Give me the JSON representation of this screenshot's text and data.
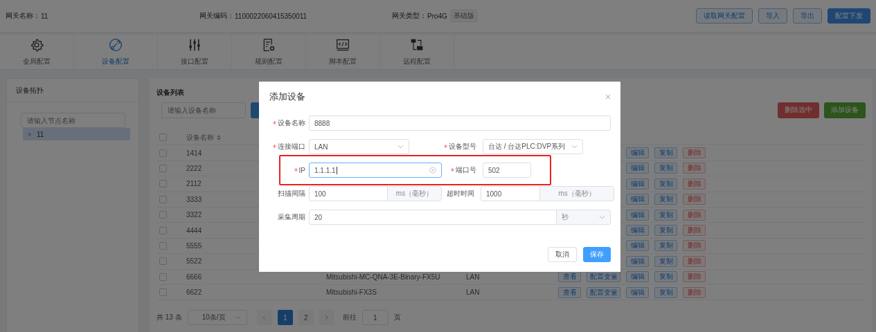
{
  "header": {
    "fields": [
      {
        "label": "网关名称：",
        "value": "11"
      },
      {
        "label": "网关编码：",
        "value": "1100022060415350011"
      },
      {
        "label": "网关类型：",
        "value": "Pro4G",
        "tag": "基础版"
      }
    ],
    "buttons": [
      {
        "label": "读取网关配置",
        "kind": "outline"
      },
      {
        "label": "导入",
        "kind": "outline"
      },
      {
        "label": "导出",
        "kind": "outline"
      },
      {
        "label": "配置下发",
        "kind": "primary"
      }
    ]
  },
  "nav": [
    {
      "label": "全局配置",
      "selected": false
    },
    {
      "label": "设备配置",
      "selected": true
    },
    {
      "label": "接口配置",
      "selected": false
    },
    {
      "label": "规则配置",
      "selected": false
    },
    {
      "label": "脚本配置",
      "selected": false
    },
    {
      "label": "远程配置",
      "selected": false
    }
  ],
  "topology": {
    "title": "设备拓扑",
    "search": {
      "placeholder": "请输入节点名称"
    },
    "tree": [
      {
        "label": "11",
        "expanded": false,
        "selected": true
      }
    ]
  },
  "device_list": {
    "title": "设备列表",
    "search": {
      "placeholder": "请输入设备名称"
    },
    "buttons": [
      {
        "label": "删除选中",
        "kind": "danger"
      },
      {
        "label": "添加设备",
        "kind": "success"
      }
    ],
    "header_checked": false,
    "columns": [
      {
        "label": "设备名称",
        "sortable": true
      }
    ],
    "rows": [
      {
        "checked": false,
        "name": "1414",
        "actions": [
          {
            "label": "编辑",
            "kind": "edit"
          },
          {
            "label": "复制",
            "kind": "copy"
          },
          {
            "label": "删除",
            "kind": "delete"
          }
        ]
      },
      {
        "checked": false,
        "name": "2222",
        "actions": [
          {
            "label": "编辑",
            "kind": "edit"
          },
          {
            "label": "复制",
            "kind": "copy"
          },
          {
            "label": "删除",
            "kind": "delete"
          }
        ]
      },
      {
        "checked": false,
        "name": "2112",
        "actions": [
          {
            "label": "编辑",
            "kind": "edit"
          },
          {
            "label": "复制",
            "kind": "copy"
          },
          {
            "label": "删除",
            "kind": "delete"
          }
        ]
      },
      {
        "checked": false,
        "name": "3333",
        "actions": [
          {
            "label": "编辑",
            "kind": "edit"
          },
          {
            "label": "复制",
            "kind": "copy"
          },
          {
            "label": "删除",
            "kind": "delete"
          }
        ]
      },
      {
        "checked": false,
        "name": "3322",
        "actions": [
          {
            "label": "编辑",
            "kind": "edit"
          },
          {
            "label": "复制",
            "kind": "copy"
          },
          {
            "label": "删除",
            "kind": "delete"
          }
        ]
      },
      {
        "checked": false,
        "name": "4444",
        "actions": [
          {
            "label": "编辑",
            "kind": "edit"
          },
          {
            "label": "复制",
            "kind": "copy"
          },
          {
            "label": "删除",
            "kind": "delete"
          }
        ]
      },
      {
        "checked": false,
        "name": "5555",
        "actions": [
          {
            "label": "编辑",
            "kind": "edit"
          },
          {
            "label": "复制",
            "kind": "copy"
          },
          {
            "label": "删除",
            "kind": "delete"
          }
        ]
      },
      {
        "checked": false,
        "name": "5522",
        "actions": [
          {
            "label": "编辑",
            "kind": "edit"
          },
          {
            "label": "复制",
            "kind": "copy"
          },
          {
            "label": "删除",
            "kind": "delete"
          }
        ]
      },
      {
        "checked": false,
        "name": "6666",
        "model": "Mitsubishi-MC-QNA-3E-Binary-FX5U",
        "port": "LAN",
        "actions": [
          {
            "label": "查看",
            "kind": "view"
          },
          {
            "label": "配置变量",
            "kind": "config"
          },
          {
            "label": "编辑",
            "kind": "edit"
          },
          {
            "label": "复制",
            "kind": "copy"
          },
          {
            "label": "删除",
            "kind": "delete"
          }
        ]
      },
      {
        "checked": false,
        "name": "6622",
        "model": "Mitsubishi-FX3S",
        "port": "LAN",
        "actions": [
          {
            "label": "查看",
            "kind": "view"
          },
          {
            "label": "配置变量",
            "kind": "config"
          },
          {
            "label": "编辑",
            "kind": "edit"
          },
          {
            "label": "复制",
            "kind": "copy"
          },
          {
            "label": "删除",
            "kind": "delete"
          }
        ]
      }
    ],
    "pagination": {
      "total": "共 13 条",
      "page_size": "10条/页",
      "pages": [
        {
          "label": "1",
          "selected": true
        },
        {
          "label": "2",
          "selected": false
        }
      ],
      "goto_label": "前往",
      "goto_value": "1",
      "page_suffix": "页"
    }
  },
  "dialog": {
    "title": "添加设备",
    "rows": [
      [
        {
          "label": "设备名称",
          "required": true,
          "kind": "input",
          "value": "8888",
          "focused": false
        }
      ],
      [
        {
          "label": "连接端口",
          "required": true,
          "kind": "select",
          "value": "LAN"
        },
        {
          "label": "设备型号",
          "required": true,
          "kind": "select",
          "value": "台达 / 台达PLC:DVP系列"
        }
      ],
      [
        {
          "label": "IP",
          "required": true,
          "kind": "input",
          "value": "1.1.1.1",
          "focused": true,
          "highlighted": true
        },
        {
          "label": "端口号",
          "required": true,
          "kind": "input",
          "value": "502",
          "focused": false,
          "highlighted": true
        }
      ],
      [
        {
          "label": "扫描间隔",
          "required": false,
          "kind": "input_unit",
          "value": "100",
          "unit": "ms（毫秒）"
        },
        {
          "label": "超时时间",
          "required": false,
          "kind": "input_unit",
          "value": "1000",
          "unit": "ms（毫秒）"
        }
      ],
      [
        {
          "label": "采集周期",
          "required": false,
          "kind": "input_select",
          "value": "20",
          "unit": "秒"
        }
      ]
    ],
    "buttons": [
      {
        "label": "取消",
        "kind": "default"
      },
      {
        "label": "保存",
        "kind": "primary"
      }
    ]
  }
}
